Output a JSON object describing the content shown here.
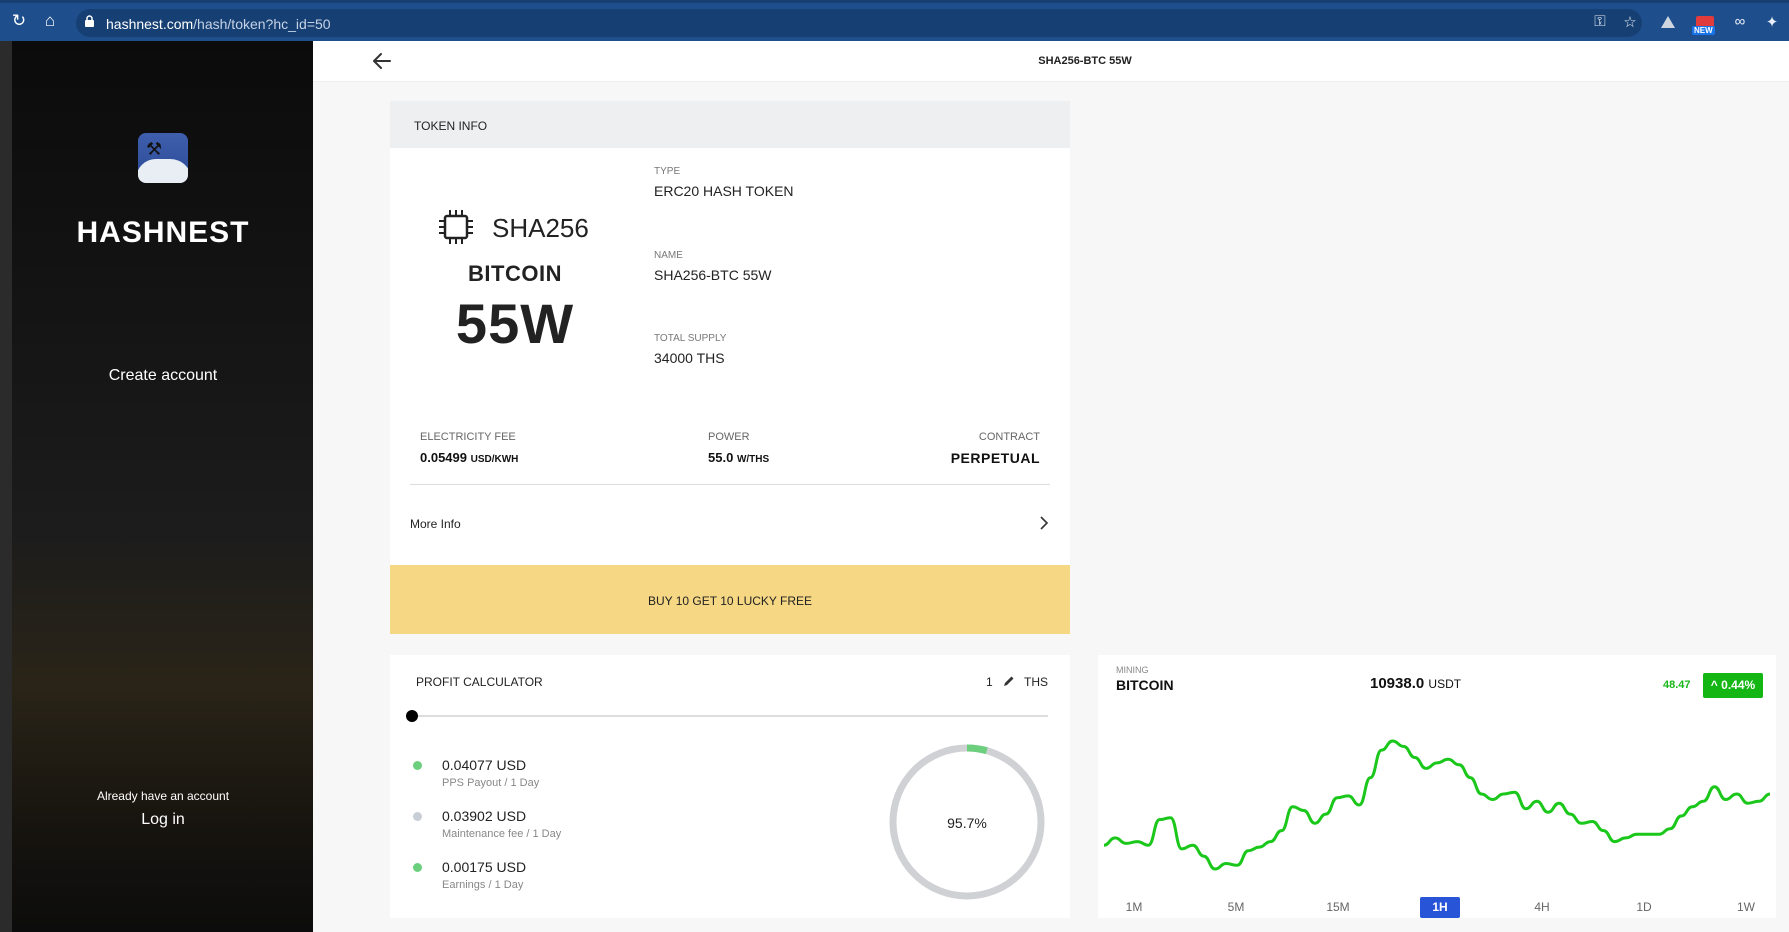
{
  "browser": {
    "url_host": "hashnest.com",
    "url_path": "/hash/token?hc_id=50",
    "icons": [
      "reload-icon",
      "home-icon",
      "lock-icon",
      "key-icon",
      "star-icon",
      "drive-icon",
      "new-extension-icon",
      "link-icon",
      "puzzle-icon"
    ],
    "new_badge": "NEW"
  },
  "sidebar": {
    "brand": "HASHNEST",
    "create_account": "Create account",
    "already_have_account": "Already have an account",
    "log_in": "Log in"
  },
  "header": {
    "title": "SHA256-BTC 55W"
  },
  "token_info": {
    "section_label": "TOKEN INFO",
    "algorithm": "SHA256",
    "coin": "BITCOIN",
    "power": "55W",
    "fields": {
      "type_label": "TYPE",
      "type_value": "ERC20 HASH TOKEN",
      "name_label": "NAME",
      "name_value": "SHA256-BTC 55W",
      "supply_label": "TOTAL SUPPLY",
      "supply_value": "34000 THS"
    },
    "specs": {
      "electricity_label": "ELECTRICITY FEE",
      "electricity_value": "0.05499",
      "electricity_unit": "USD/KWH",
      "power_label": "POWER",
      "power_value": "55.0",
      "power_unit": "W/THS",
      "contract_label": "CONTRACT",
      "contract_value": "PERPETUAL"
    },
    "more_info": "More Info",
    "promo": "BUY 10 GET 10 LUCKY FREE"
  },
  "profit_calculator": {
    "title": "PROFIT CALCULATOR",
    "quantity": "1",
    "unit": "THS",
    "rows": [
      {
        "value": "0.04077 USD",
        "label": "PPS Payout / 1 Day",
        "color": "#6ccf7e"
      },
      {
        "value": "0.03902 USD",
        "label": "Maintenance fee / 1 Day",
        "color": "#c9cdd6"
      },
      {
        "value": "0.00175 USD",
        "label": "Earnings / 1 Day",
        "color": "#6ccf7e"
      }
    ],
    "donut_percent_label": "95.7%",
    "donut_maintenance_share": 0.957,
    "colors": {
      "earnings": "#6ccf7e",
      "maintenance": "#cfd1d4"
    }
  },
  "mining": {
    "label": "MINING",
    "coin": "BITCOIN",
    "price": "10938.0",
    "price_unit": "USDT",
    "change_abs": "48.47",
    "change_pct": "0.44%",
    "up_color": "#13b613",
    "timeframes": [
      "1M",
      "5M",
      "15M",
      "1H",
      "4H",
      "1D",
      "1W"
    ],
    "active_timeframe": "1H"
  },
  "chart_data": {
    "type": "line",
    "title": "",
    "xlabel": "",
    "ylabel": "",
    "series": [
      {
        "values": [
          10868,
          10872,
          10869,
          10870,
          10868,
          10882,
          10883,
          10866,
          10868,
          10862,
          10855,
          10858,
          10857,
          10865,
          10867,
          10870,
          10876,
          10889,
          10887,
          10880,
          10885,
          10894,
          10895,
          10890,
          10905,
          10920,
          10925,
          10922,
          10916,
          10910,
          10913,
          10915,
          10912,
          10905,
          10896,
          10893,
          10896,
          10897,
          10888,
          10892,
          10886,
          10891,
          10885,
          10880,
          10881,
          10876,
          10870,
          10872,
          10874,
          10874,
          10874,
          10877,
          10884,
          10889,
          10892,
          10900,
          10893,
          10896,
          10891,
          10892,
          10896
        ]
      }
    ],
    "grid": false,
    "legend": "none"
  }
}
